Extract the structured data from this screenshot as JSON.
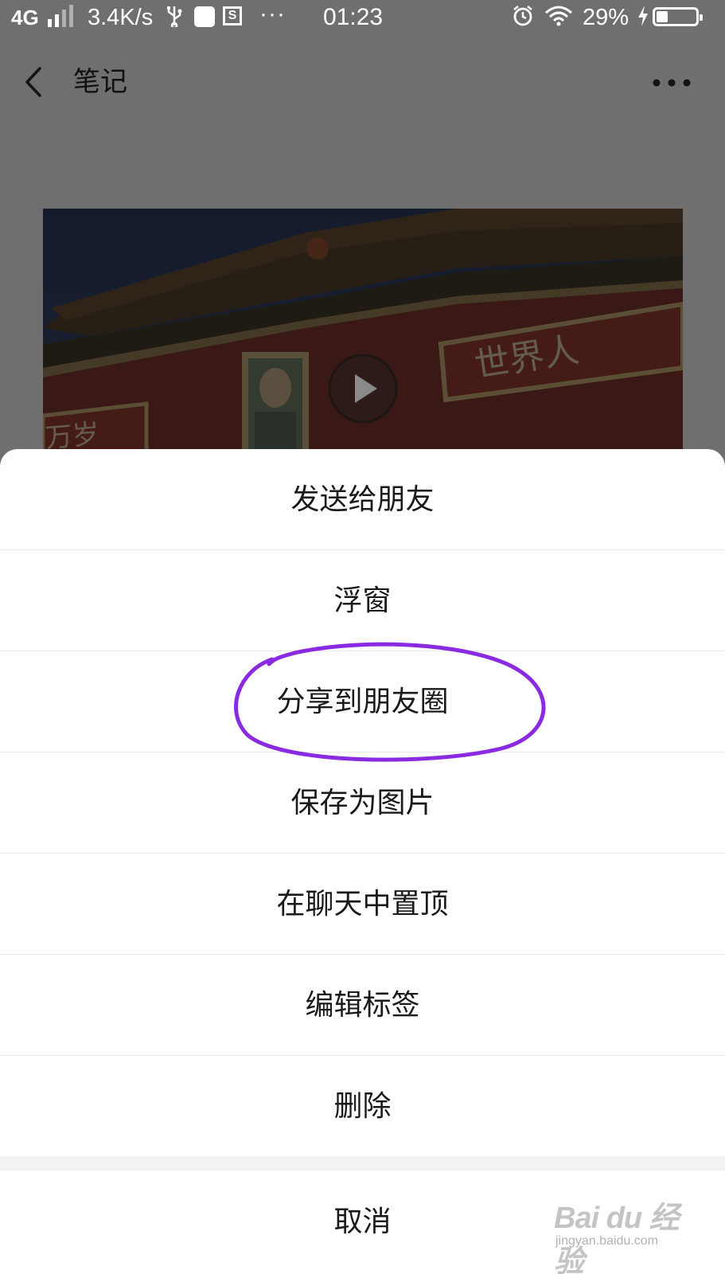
{
  "status_bar": {
    "network": "4G",
    "speed": "3.4K/s",
    "more": "···",
    "time": "01:23",
    "battery_percent": "29%",
    "battery_level": 0.29,
    "signal_bars_active": 2
  },
  "nav": {
    "title": "笔记",
    "back_icon": "chevron-left-icon",
    "more_icon": "more-dots-icon"
  },
  "content": {
    "image_desc_icon": "video-thumbnail",
    "play_icon": "play-icon"
  },
  "action_sheet": {
    "items": [
      {
        "label": "发送给朋友"
      },
      {
        "label": "浮窗"
      },
      {
        "label": "分享到朋友圈"
      },
      {
        "label": "保存为图片"
      },
      {
        "label": "在聊天中置顶"
      },
      {
        "label": "编辑标签"
      },
      {
        "label": "删除"
      }
    ],
    "cancel_label": "取消",
    "highlight_color": "#8a2be2"
  },
  "watermark": {
    "brand": "Bai du 经验",
    "url": "jingyan.baidu.com"
  }
}
